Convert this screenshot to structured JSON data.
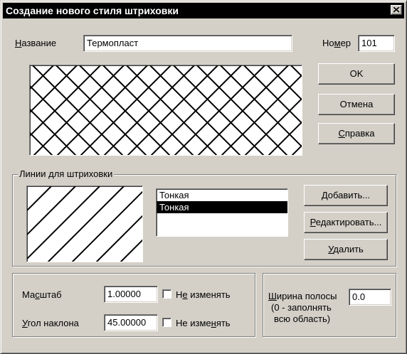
{
  "window": {
    "title": "Создание нового стиля штриховки"
  },
  "form": {
    "name_label_accel": "Н",
    "name_label_rest": "азвание",
    "name_value": "Термопласт",
    "number_label_pre": "Но",
    "number_label_accel": "м",
    "number_label_post": "ер",
    "number_value": "101"
  },
  "buttons": {
    "ok": "OK",
    "cancel": "Отмена",
    "help_accel": "С",
    "help_rest": "правка",
    "add_accel": "Д",
    "add_rest": "обавить...",
    "edit_accel": "Р",
    "edit_rest": "едактировать...",
    "delete_accel": "У",
    "delete_rest": "далить"
  },
  "lines_group": {
    "caption": "Линии для штриховки",
    "items": [
      {
        "label": "Тонкая",
        "selected": false
      },
      {
        "label": "Тонкая",
        "selected": true
      }
    ]
  },
  "scale_group": {
    "scale_label_pre": "Ма",
    "scale_label_accel": "с",
    "scale_label_post": "штаб",
    "scale_value": "1.00000",
    "scale_lock_pre": "Н",
    "scale_lock_accel": "е",
    "scale_lock_post": " изменять",
    "angle_label_accel": "У",
    "angle_label_rest": "гол наклона",
    "angle_value": "45.00000",
    "angle_lock_pre": "Не изме",
    "angle_lock_accel": "н",
    "angle_lock_post": "ять"
  },
  "width_group": {
    "label_accel": "Ш",
    "label_rest": "ирина полосы",
    "hint_line1": "(0 -  заполнять",
    "hint_line2": "всю область)",
    "value": "0.0"
  }
}
